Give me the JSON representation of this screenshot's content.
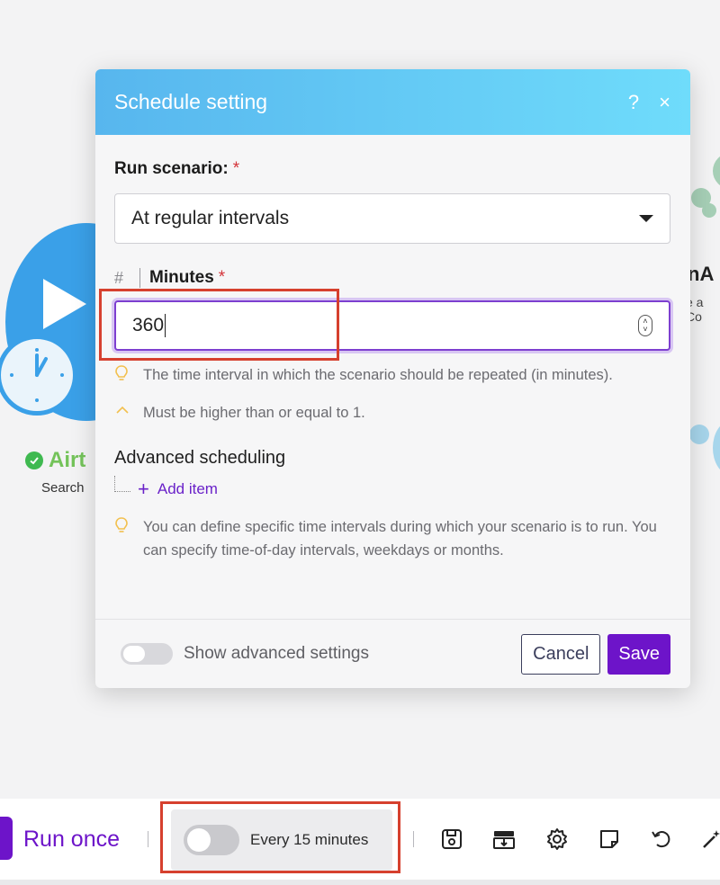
{
  "modal": {
    "title": "Schedule setting",
    "help_icon": "?",
    "close_icon": "×",
    "run_scenario_label": "Run scenario:",
    "required_mark": "*",
    "run_scenario_value": "At regular intervals",
    "minutes_type_icon": "#",
    "minutes_label": "Minutes",
    "minutes_value": "360",
    "hint_interval": "The time interval in which the scenario should be repeated (in minutes).",
    "hint_min": "Must be higher than or equal to 1.",
    "advanced_scheduling_title": "Advanced scheduling",
    "add_item_label": "Add item",
    "hint_advanced": "You can define specific time intervals during which your scenario is to run. You can specify time-of-day intervals, weekdays or months.",
    "show_advanced_label": "Show advanced settings",
    "show_advanced_on": false,
    "cancel_label": "Cancel",
    "save_label": "Save"
  },
  "background": {
    "module_name": "Airt",
    "module_sub": "Search",
    "right_label": "nA",
    "right_sub": "e a Co"
  },
  "toolbar": {
    "run_once_label": "Run once",
    "schedule_label": "Every 15 minutes",
    "schedule_on": false,
    "icons": [
      "save-icon",
      "export-blueprint-icon",
      "settings-gear-icon",
      "notes-icon",
      "undo-icon",
      "magic-wand-icon"
    ]
  },
  "colors": {
    "accent": "#6d14c9",
    "header_start": "#57b6ee",
    "header_end": "#6fdcfb",
    "highlight": "#d6402e",
    "required": "#d4343a",
    "hint_icon": "#f2c04f"
  }
}
